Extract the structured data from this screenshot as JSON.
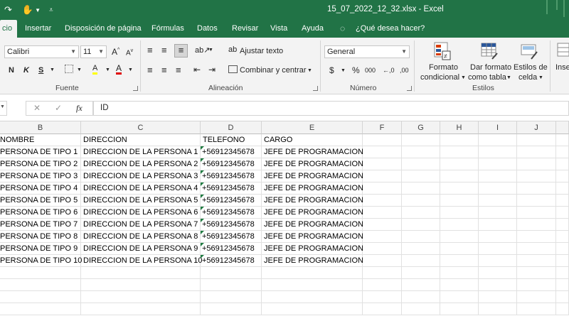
{
  "window": {
    "title": "15_07_2022_12_32.xlsx  -  Excel"
  },
  "tabs": [
    {
      "label": "cio",
      "active": true
    },
    {
      "label": "Insertar"
    },
    {
      "label": "Disposición de página"
    },
    {
      "label": "Fórmulas"
    },
    {
      "label": "Datos"
    },
    {
      "label": "Revisar"
    },
    {
      "label": "Vista"
    },
    {
      "label": "Ayuda"
    },
    {
      "label": "¿Qué desea hacer?"
    }
  ],
  "ribbon": {
    "font": {
      "name": "Calibri",
      "size": "11",
      "grow": "A",
      "shrink": "A",
      "bold": "N",
      "italic": "K",
      "underline": "S",
      "fill": "A",
      "color": "A",
      "group_label": "Fuente"
    },
    "alignment": {
      "wrap_text": "Ajustar texto",
      "merge_center": "Combinar y centrar",
      "group_label": "Alineación"
    },
    "number": {
      "format": "General",
      "currency": "$",
      "percent": "%",
      "thousands": "000",
      "inc_decimals": "←,0",
      "dec_decimals": ",00",
      "group_label": "Número"
    },
    "styles": {
      "conditional_1": "Formato",
      "conditional_2": "condicional",
      "table_1": "Dar formato",
      "table_2": "como tabla",
      "cell_1": "Estilos de",
      "cell_2": "celda",
      "group_label": "Estilos"
    },
    "cells": {
      "insert": "Inse"
    }
  },
  "formula_bar": {
    "fx_label": "fx",
    "cancel": "✕",
    "enter": "✓",
    "value": "ID"
  },
  "columns": [
    "B",
    "C",
    "D",
    "E",
    "F",
    "G",
    "H",
    "I",
    "J"
  ],
  "rows": [
    [
      "NOMBRE",
      "DIRECCION",
      "TELEFONO",
      "CARGO"
    ],
    [
      "PERSONA DE TIPO 1",
      "DIRECCION DE LA PERSONA 1",
      "+56912345678",
      "JEFE DE PROGRAMACION"
    ],
    [
      "PERSONA DE TIPO 2",
      "DIRECCION DE LA PERSONA 2",
      "+56912345678",
      "JEFE DE PROGRAMACION"
    ],
    [
      "PERSONA DE TIPO 3",
      "DIRECCION DE LA PERSONA 3",
      "+56912345678",
      "JEFE DE PROGRAMACION"
    ],
    [
      "PERSONA DE TIPO 4",
      "DIRECCION DE LA PERSONA 4",
      "+56912345678",
      "JEFE DE PROGRAMACION"
    ],
    [
      "PERSONA DE TIPO 5",
      "DIRECCION DE LA PERSONA 5",
      "+56912345678",
      "JEFE DE PROGRAMACION"
    ],
    [
      "PERSONA DE TIPO 6",
      "DIRECCION DE LA PERSONA 6",
      "+56912345678",
      "JEFE DE PROGRAMACION"
    ],
    [
      "PERSONA DE TIPO 7",
      "DIRECCION DE LA PERSONA 7",
      "+56912345678",
      "JEFE DE PROGRAMACION"
    ],
    [
      "PERSONA DE TIPO 8",
      "DIRECCION DE LA PERSONA 8",
      "+56912345678",
      "JEFE DE PROGRAMACION"
    ],
    [
      "PERSONA DE TIPO 9",
      "DIRECCION DE LA PERSONA 9",
      "+56912345678",
      "JEFE DE PROGRAMACION"
    ],
    [
      "PERSONA DE TIPO 10",
      "DIRECCION DE LA PERSONA 10",
      "+56912345678",
      "JEFE DE PROGRAMACION"
    ]
  ],
  "colors": {
    "brand": "#217346",
    "ribbon_bg": "#f3f3f3",
    "grid_line": "#e1e1e1",
    "number_as_text_flag": "#1e7b40"
  }
}
